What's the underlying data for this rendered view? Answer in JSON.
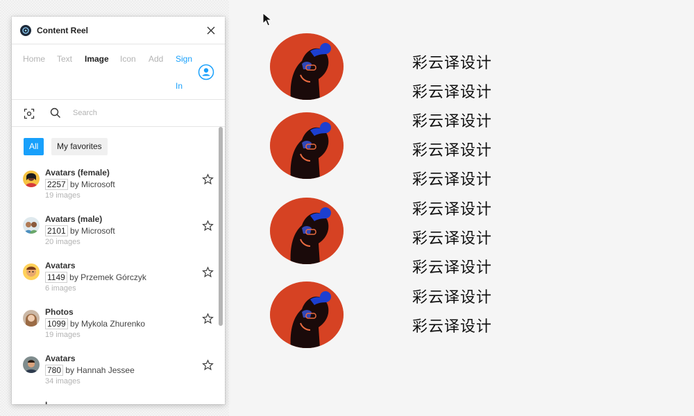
{
  "plugin": {
    "title": "Content Reel",
    "tabs": [
      {
        "label": "Home",
        "active": false
      },
      {
        "label": "Text",
        "active": false
      },
      {
        "label": "Image",
        "active": true
      },
      {
        "label": "Icon",
        "active": false
      },
      {
        "label": "Add",
        "active": false
      }
    ],
    "sign_in": {
      "line1": "Sign",
      "line2": "In"
    },
    "search": {
      "placeholder": "Search",
      "value": ""
    },
    "filters": {
      "all": "All",
      "favorites": "My favorites",
      "active": "All"
    },
    "items": [
      {
        "name": "Avatars (female)",
        "count": "2257",
        "author": "by Microsoft",
        "images": "19 images",
        "avatar": "female-avatar-icon"
      },
      {
        "name": "Avatars (male)",
        "count": "2101",
        "author": "by Microsoft",
        "images": "20 images",
        "avatar": "male-avatar-icon"
      },
      {
        "name": "Avatars",
        "count": "1149",
        "author": "by Przemek Górczyk",
        "images": "6 images",
        "avatar": "emoji-avatar-icon"
      },
      {
        "name": "Photos",
        "count": "1099",
        "author": "by Mykola Zhurenko",
        "images": "19 images",
        "avatar": "photo-avatar-icon"
      },
      {
        "name": "Avatars",
        "count": "780",
        "author": "by Hannah Jessee",
        "images": "34 images",
        "avatar": "portrait-avatar-icon"
      }
    ],
    "peek_text": "I"
  },
  "canvas": {
    "text_lines": [
      "彩云译设计",
      "彩云译设计",
      "彩云译设计",
      "彩云译设计",
      "彩云译设计",
      "彩云译设计",
      "彩云译设计",
      "彩云译设计",
      "彩云译设计",
      "彩云译设计"
    ],
    "portrait_count": 4,
    "portrait_colors": {
      "red": "#d5361f",
      "blue": "#1c3fd0",
      "dark": "#1a0a0a"
    }
  },
  "colors": {
    "accent": "#18a0fb",
    "muted": "#b3b3b3"
  }
}
